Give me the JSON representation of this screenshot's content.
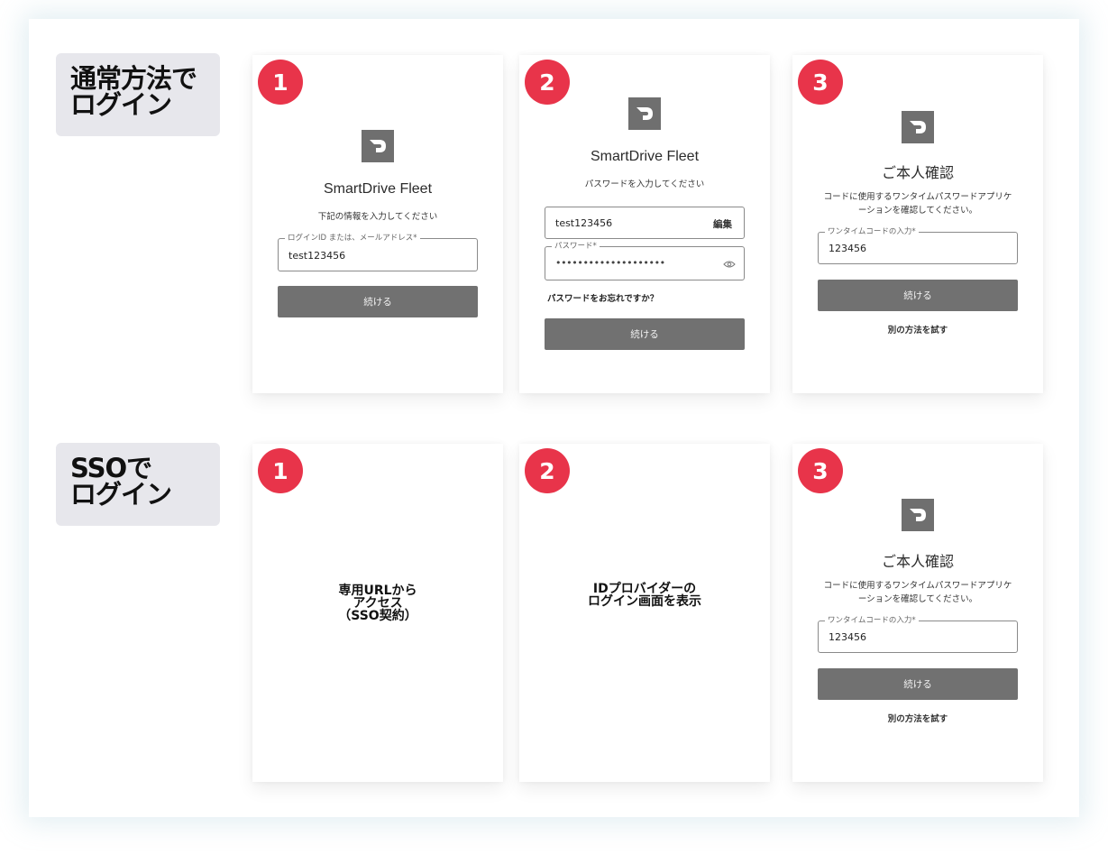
{
  "sections": {
    "normal": {
      "label_line1": "通常方法で",
      "label_line2": "ログイン"
    },
    "sso": {
      "label_line1": "SSOで",
      "label_line2": "ログイン"
    }
  },
  "normal_cards": {
    "card1": {
      "step": "1",
      "app_title": "SmartDrive Fleet",
      "instruction": "下記の情報を入力してください",
      "field_label": "ログインID または、メールアドレス*",
      "field_value": "test123456",
      "button": "続ける"
    },
    "card2": {
      "step": "2",
      "app_title": "SmartDrive Fleet",
      "instruction": "パスワードを入力してください",
      "id_value": "test123456",
      "edit_label": "編集",
      "password_label": "パスワード*",
      "password_value": "••••••••••••••••••••",
      "forgot_link": "パスワードをお忘れですか？",
      "button": "続ける"
    },
    "card3": {
      "step": "3",
      "title": "ご本人確認",
      "instruction_line1": "コードに使用するワンタイムパスワードアプリケ",
      "instruction_line2": "ーションを確認してください。",
      "field_label": "ワンタイムコードの入力*",
      "field_value": "123456",
      "button": "続ける",
      "alt_link": "別の方法を試す"
    }
  },
  "sso_cards": {
    "card1": {
      "step": "1",
      "line1": "専用URLから",
      "line2": "アクセス",
      "line3": "（SSO契約）"
    },
    "card2": {
      "step": "2",
      "line1": "IDプロバイダーの",
      "line2": "ログイン画面を表示"
    },
    "card3": {
      "step": "3",
      "title": "ご本人確認",
      "instruction_line1": "コードに使用するワンタイムパスワードアプリケ",
      "instruction_line2": "ーションを確認してください。",
      "field_label": "ワンタイムコードの入力*",
      "field_value": "123456",
      "button": "続ける",
      "alt_link": "別の方法を試す"
    }
  },
  "colors": {
    "step_badge": "#e8344a",
    "button": "#717171",
    "logo": "#6f6f6f",
    "label_bg": "#e7e7ec"
  },
  "icons": {
    "logo": "smartdrive-logo-icon",
    "eye": "eye-icon"
  }
}
